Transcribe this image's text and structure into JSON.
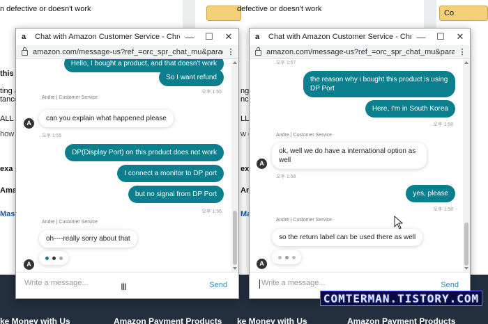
{
  "background": {
    "left_top_text": "n defective or doesn't work",
    "right_top_text": "defective or doesn't work",
    "button_partial_left": "",
    "button_partial_right": "Co",
    "left_col_lines": [
      "this i",
      "ting ar",
      "tance",
      "ALL M",
      "how doe",
      "exa",
      "Ama",
      "Maste"
    ],
    "mid_col_lines": [
      "his",
      "ng",
      "nce",
      "LL M",
      "w doe",
      "exa",
      "Ama",
      "Maste"
    ],
    "footer_left_1": "ke Money with Us",
    "footer_left_2": "Amazon Payment Products",
    "footer_right_1": "ke Money with Us",
    "footer_right_2": "Amazon Payment Products",
    "watermark": "COMTERMAN.TISTORY.COM"
  },
  "windows": [
    {
      "title": "Chat with Amazon Customer Service - Chrome",
      "url": "amazon.com/message-us?ref_=orc_spr_chat_mu&paradigm=pls&mu...",
      "messages": {
        "m0": "Hello, I bought a product, and that doesn't work",
        "m1": "So I want refund",
        "t1": "오후 1:55",
        "agent1": "Andre | Customer Service",
        "m2": "can you explain what happened please",
        "t2": "오후 1:55",
        "m3": "DP(Display Port) on this product does not work",
        "m4": "I connect a monitor to DP port",
        "m5": "but no signal from DP Port",
        "t3": "오후 1:56",
        "agent2": "Andre | Customer Service",
        "m6": "oh----really sorry about that",
        "avatar": "A"
      },
      "composer_placeholder": "Write a message...",
      "send_label": "Send"
    },
    {
      "title": "Chat with Amazon Customer Service - Chrome",
      "url": "amazon.com/message-us?ref_=orc_spr_chat_mu&paradigm=pls&mu...",
      "messages": {
        "t0": "오후 1:57",
        "m1": "the reason why i bought this product is using DP Port",
        "m2": "Here, I'm in South Korea",
        "t1": "오후 1:58",
        "agent1": "Andre | Customer Service",
        "m3": "ok, well we do have a international option as well",
        "t2": "오후 1:58",
        "m4": "yes, please",
        "t3": "오후 1:58",
        "agent2": "Andre | Customer Service",
        "m5": "so the return label can be used there as well",
        "avatar": "A"
      },
      "composer_placeholder": "Write a message...",
      "send_label": "Send"
    }
  ],
  "colors": {
    "outgoing_bubble": "#0c7f8e",
    "send_link": "#2a8ab8",
    "footer_bg": "#232f3e",
    "amazon_button": "#f4d078"
  }
}
